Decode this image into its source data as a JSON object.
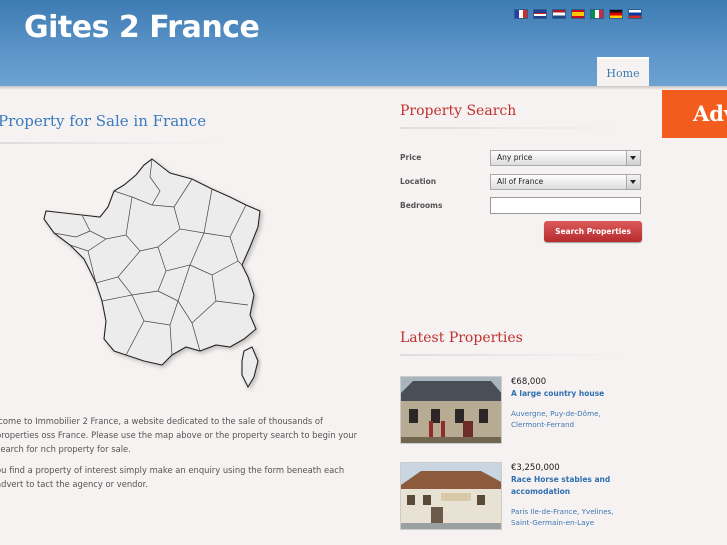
{
  "header": {
    "site_title": "Gites 2 France",
    "nav": {
      "home": "Home"
    },
    "languages": [
      "French",
      "English",
      "Dutch",
      "Spanish",
      "Italian",
      "German",
      "Russian"
    ]
  },
  "left": {
    "title": "Property for Sale in France",
    "intro": [
      "lcome to Immobilier 2 France, a website dedicated to the sale of thousands of properties oss France. Please use the map above or the property search to begin your search for nch property for sale.",
      "ou find a property of interest simply make an enquiry using the form beneath each advert to tact the agency or vendor."
    ]
  },
  "search": {
    "title": "Property Search",
    "price_label": "Price",
    "price_value": "Any price",
    "location_label": "Location",
    "location_value": "All of France",
    "bedrooms_label": "Bedrooms",
    "bedrooms_value": "",
    "button": "Search Properties"
  },
  "ad": {
    "text": "Adv"
  },
  "latest": {
    "title": "Latest Properties",
    "items": [
      {
        "price": "€68,000",
        "title": "A large country house",
        "location": "Auvergne, Puy-de-Dôme, Clermont-Ferrand"
      },
      {
        "price": "€3,250,000",
        "title": "Race Horse stables and accomodation",
        "location": "Paris Ile-de-France, Yvelines, Saint-Germain-en-Laye"
      }
    ]
  },
  "colors": {
    "header_blue": "#4a86bf",
    "title_blue": "#3a7bbd",
    "title_red": "#c0302f",
    "button_red": "#c03b3d",
    "ad_orange": "#f25c1c"
  }
}
